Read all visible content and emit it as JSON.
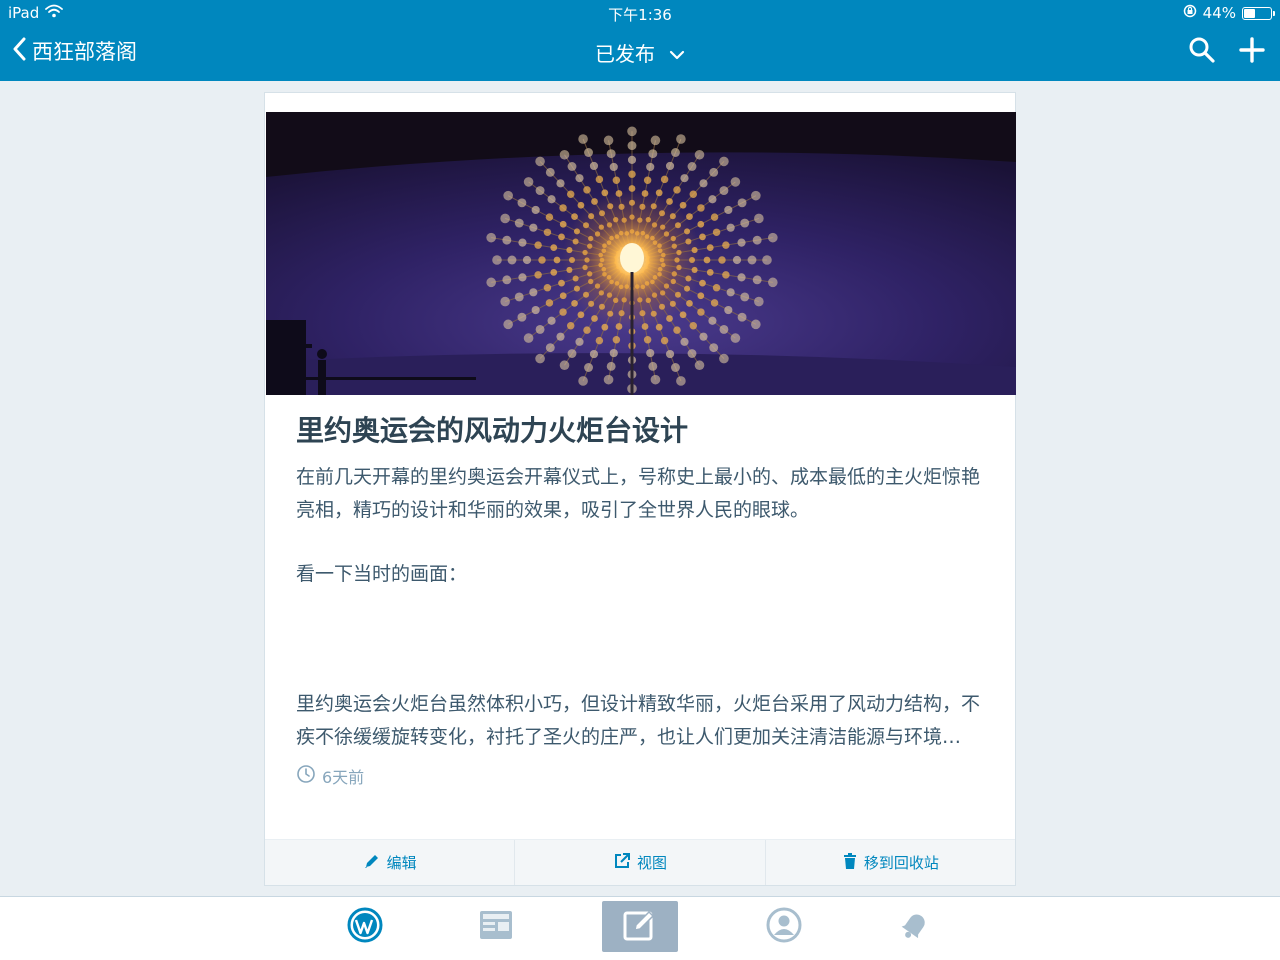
{
  "status": {
    "device": "iPad",
    "time": "下午1:36",
    "battery": "44%",
    "battery_level": 0.44
  },
  "nav": {
    "back_label": "西狂部落阁",
    "title": "已发布"
  },
  "post": {
    "title": "里约奥运会的风动力火炬台设计",
    "para1": "在前几天开幕的里约奥运会开幕仪式上，号称史上最小的、成本最低的主火炬惊艳亮相，精巧的设计和华丽的效果，吸引了全世界人民的眼球。",
    "para2": "看一下当时的画面：",
    "para3": "里约奥运会火炬台虽然体积小巧，但设计精致华丽，火炬台采用了风动力结构，不疾不徐缓缓旋转变化，衬托了圣火的庄严，也让人们更加关注清洁能源与环境…",
    "time_ago": "6天前"
  },
  "actions": {
    "edit": "编辑",
    "view": "视图",
    "trash": "移到回收站"
  },
  "tabs": [
    {
      "name": "wordpress-icon",
      "active": false
    },
    {
      "name": "reader-icon",
      "active": false
    },
    {
      "name": "write-icon",
      "active": true
    },
    {
      "name": "me-icon",
      "active": false
    },
    {
      "name": "notifications-icon",
      "active": false
    }
  ],
  "colors": {
    "accent": "#0087be",
    "background": "#e9eff3",
    "active_tab": "#9db1c3"
  }
}
